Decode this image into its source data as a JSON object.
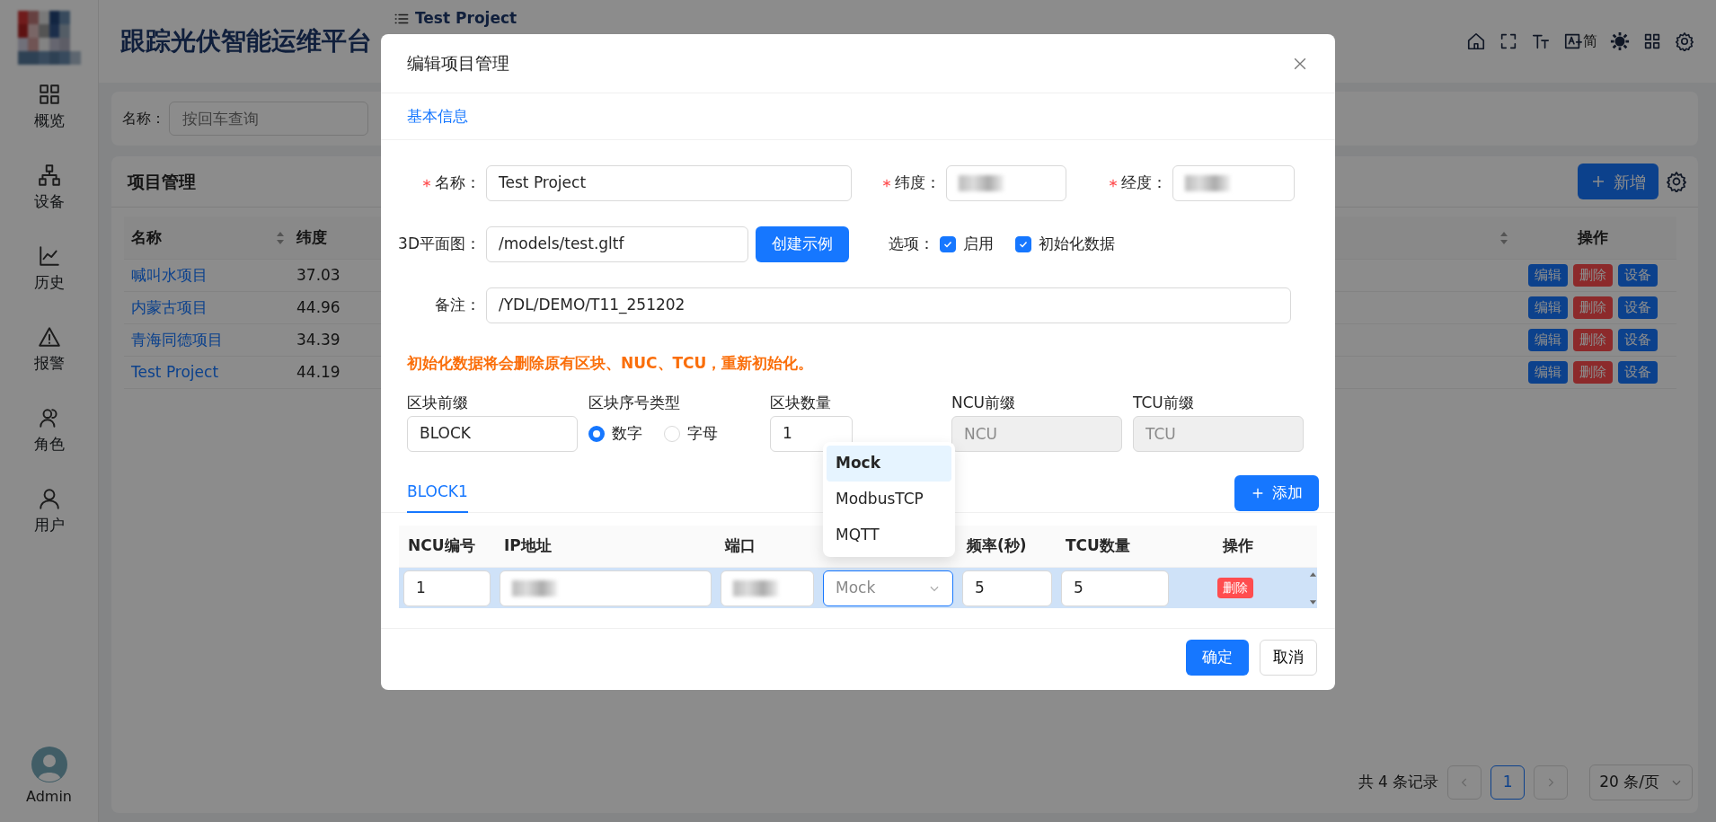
{
  "sidebar": {
    "items": [
      {
        "label": "概览"
      },
      {
        "label": "设备"
      },
      {
        "label": "历史"
      },
      {
        "label": "报警"
      },
      {
        "label": "角色"
      },
      {
        "label": "用户"
      }
    ],
    "user": {
      "name": "Admin"
    }
  },
  "header": {
    "title": "跟踪光伏智能运维平台",
    "breadcrumb": "Test Project",
    "lang_label": "简"
  },
  "search": {
    "label": "名称：",
    "placeholder": "按回车查询"
  },
  "project_table": {
    "title": "项目管理",
    "add_button": "新增",
    "columns": [
      "名称",
      "纬度",
      "操作"
    ],
    "rows": [
      {
        "name": "喊叫水项目",
        "lat": "37.03",
        "actions": [
          "编辑",
          "删除",
          "设备"
        ]
      },
      {
        "name": "内蒙古项目",
        "lat": "44.96",
        "actions": [
          "编辑",
          "删除",
          "设备"
        ]
      },
      {
        "name": "青海同德项目",
        "lat": "34.39",
        "actions": [
          "编辑",
          "删除",
          "设备"
        ]
      },
      {
        "name": "Test Project",
        "lat": "44.19",
        "actions": [
          "编辑",
          "删除",
          "设备"
        ]
      }
    ],
    "pagination": {
      "total": "共 4 条记录",
      "page": "1",
      "page_size": "20 条/页"
    }
  },
  "modal": {
    "title": "编辑项目管理",
    "section": "基本信息",
    "name": {
      "label": "名称：",
      "required": true,
      "value": "Test Project"
    },
    "latitude": {
      "label": "纬度：",
      "required": true,
      "redacted": true
    },
    "longitude": {
      "label": "经度：",
      "required": true,
      "redacted": true
    },
    "model": {
      "label": "3D平面图：",
      "value": "/models/test.gltf",
      "button": "创建示例"
    },
    "options": {
      "label": "选项：",
      "items": [
        {
          "label": "启用",
          "checked": true
        },
        {
          "label": "初始化数据",
          "checked": true
        }
      ]
    },
    "note": {
      "label": "备注：",
      "value": "/YDL/DEMO/T11_251202"
    },
    "warning": "初始化数据将会删除原有区块、NUC、TCU，重新初始化。",
    "block_prefix": {
      "label": "区块前缀",
      "value": "BLOCK"
    },
    "seq_type": {
      "label": "区块序号类型",
      "options": [
        {
          "label": "数字",
          "selected": true
        },
        {
          "label": "字母",
          "selected": false
        }
      ]
    },
    "block_count": {
      "label": "区块数量",
      "value": "1"
    },
    "ncu_prefix": {
      "label": "NCU前缀",
      "placeholder": "NCU",
      "disabled": true
    },
    "tcu_prefix": {
      "label": "TCU前缀",
      "placeholder": "TCU",
      "disabled": true
    },
    "tabs": [
      {
        "label": "BLOCK1",
        "selected": true
      }
    ],
    "add_button": "添加",
    "ncu_table": {
      "columns": [
        "NCU编号",
        "IP地址",
        "端口",
        "",
        "频率(秒)",
        "TCU数量",
        "操作"
      ],
      "rows": [
        {
          "selected": true,
          "cells": [
            {
              "kind": "input",
              "value": "1"
            },
            {
              "kind": "redacted"
            },
            {
              "kind": "redacted"
            },
            {
              "kind": "select",
              "value": "Mock",
              "open": true
            },
            {
              "kind": "input",
              "value": "5"
            },
            {
              "kind": "input",
              "value": "5"
            },
            {
              "kind": "button",
              "label": "删除"
            }
          ]
        }
      ]
    },
    "dropdown": [
      {
        "label": "Mock",
        "selected": true
      },
      {
        "label": "ModbusTCP",
        "selected": false
      },
      {
        "label": "MQTT",
        "selected": false
      }
    ],
    "ok_button": "确定",
    "cancel_button": "取消"
  }
}
